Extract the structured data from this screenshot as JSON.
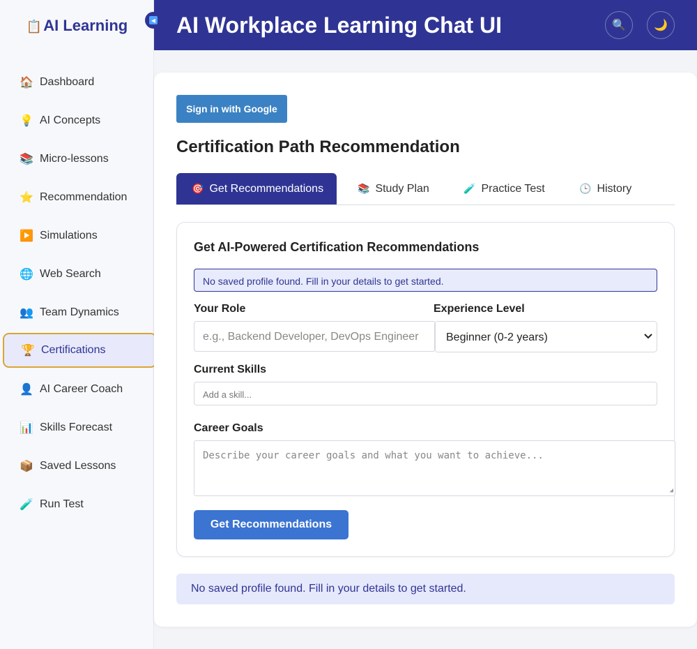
{
  "sidebar": {
    "brand": {
      "icon": "📋",
      "label": "AI Learning"
    },
    "items": [
      {
        "icon": "🏠",
        "label": "Dashboard"
      },
      {
        "icon": "💡",
        "label": "AI Concepts"
      },
      {
        "icon": "📚",
        "label": "Micro-lessons"
      },
      {
        "icon": "⭐",
        "label": "Recommendation"
      },
      {
        "icon": "▶️",
        "label": "Simulations"
      },
      {
        "icon": "🌐",
        "label": "Web Search"
      },
      {
        "icon": "👥",
        "label": "Team Dynamics"
      },
      {
        "icon": "🏆",
        "label": "Certifications",
        "active": true
      },
      {
        "icon": "👤",
        "label": "AI Career Coach"
      },
      {
        "icon": "📊",
        "label": "Skills Forecast"
      },
      {
        "icon": "📦",
        "label": "Saved Lessons"
      },
      {
        "icon": "🧪",
        "label": "Run Test"
      }
    ]
  },
  "header": {
    "title": "AI Workplace Learning Chat UI",
    "search_icon": "🔍",
    "theme_icon": "🌙"
  },
  "main": {
    "google_button": "Sign in with Google",
    "section_title": "Certification Path Recommendation",
    "tabs": [
      {
        "icon": "🎯",
        "label": "Get Recommendations"
      },
      {
        "icon": "📚",
        "label": "Study Plan"
      },
      {
        "icon": "🧪",
        "label": "Practice Test"
      },
      {
        "icon": "🕒",
        "label": "History"
      }
    ],
    "form": {
      "title": "Get AI-Powered Certification Recommendations",
      "notice": "No saved profile found. Fill in your details to get started.",
      "role_label": "Your Role",
      "role_placeholder": "e.g., Backend Developer, DevOps Engineer",
      "experience_label": "Experience Level",
      "experience_value": "Beginner (0-2 years)",
      "skills_label": "Current Skills",
      "skills_placeholder": "Add a skill...",
      "goals_label": "Career Goals",
      "goals_placeholder": "Describe your career goals and what you want to achieve...",
      "submit_label": "Get Recommendations"
    },
    "bottom_notice": "No saved profile found. Fill in your details to get started."
  },
  "colors": {
    "brand": "#2f3494",
    "accent_button": "#3b74d1",
    "active_border": "#d9a534"
  }
}
